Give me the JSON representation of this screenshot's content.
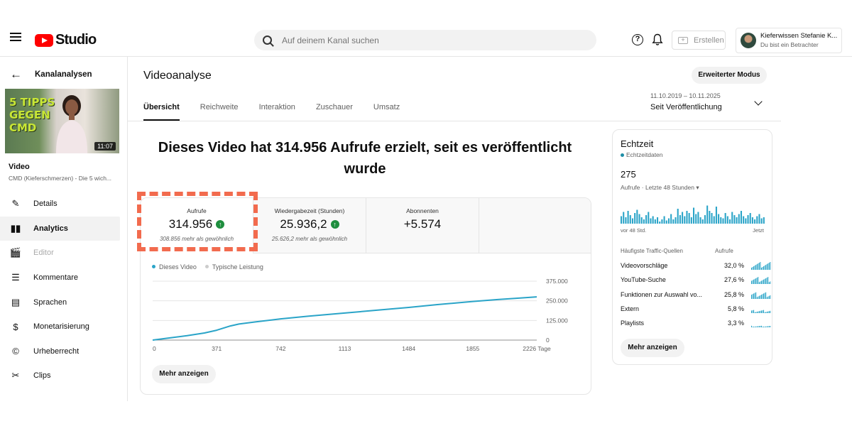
{
  "header": {
    "logo_text": "Studio",
    "search_placeholder": "Auf deinem Kanal suchen",
    "create_label": "Erstellen",
    "account_name": "Kieferwissen Stefanie K...",
    "account_role": "Du bist ein Betrachter",
    "help_glyph": "?"
  },
  "sidebar": {
    "back_label": "Kanalanalysen",
    "thumbnail_title": [
      "5 TIPPS",
      "GEGEN",
      "CMD"
    ],
    "thumbnail_duration": "11:07",
    "video_label": "Video",
    "video_subtitle": "CMD (Kieferschmerzen) - Die 5 wich...",
    "items": [
      {
        "label": "Details",
        "icon": "pencil-icon",
        "glyph": "✎",
        "state": "normal"
      },
      {
        "label": "Analytics",
        "icon": "analytics-icon",
        "glyph": "▮▮",
        "state": "active"
      },
      {
        "label": "Editor",
        "icon": "editor-icon",
        "glyph": "🎬",
        "state": "disabled"
      },
      {
        "label": "Kommentare",
        "icon": "comments-icon",
        "glyph": "☰",
        "state": "normal"
      },
      {
        "label": "Sprachen",
        "icon": "subtitles-icon",
        "glyph": "▤",
        "state": "normal"
      },
      {
        "label": "Monetarisierung",
        "icon": "dollar-icon",
        "glyph": "$",
        "state": "normal"
      },
      {
        "label": "Urheberrecht",
        "icon": "copyright-icon",
        "glyph": "©",
        "state": "normal"
      },
      {
        "label": "Clips",
        "icon": "scissors-icon",
        "glyph": "✂",
        "state": "normal"
      }
    ]
  },
  "main": {
    "title": "Videoanalyse",
    "advanced_button": "Erweiterter Modus",
    "tabs": [
      {
        "label": "Übersicht",
        "active": true
      },
      {
        "label": "Reichweite",
        "active": false
      },
      {
        "label": "Interaktion",
        "active": false
      },
      {
        "label": "Zuschauer",
        "active": false
      },
      {
        "label": "Umsatz",
        "active": false
      }
    ],
    "date_range": "11.10.2019 – 10.11.2025",
    "date_label": "Seit Veröffentlichung",
    "headline": "Dieses Video hat 314.956 Aufrufe erzielt, seit es veröffentlicht wurde",
    "metrics": [
      {
        "label": "Aufrufe",
        "value": "314.956",
        "up": true,
        "sub": "308.856 mehr als gewöhnlich"
      },
      {
        "label": "Wiedergabezeit (Stunden)",
        "value": "25.936,2",
        "up": true,
        "sub": "25.626,2 mehr als gewöhnlich"
      },
      {
        "label": "Abonnenten",
        "value": "+5.574",
        "up": false,
        "sub": ""
      }
    ],
    "up_glyph": "↑",
    "legend": [
      {
        "name": "Dieses Video",
        "color": "#2aa4c8"
      },
      {
        "name": "Typische Leistung",
        "color": "#cccccc"
      }
    ],
    "more_button": "Mehr anzeigen"
  },
  "chart_data": {
    "type": "line",
    "x_tick_labels": [
      "0",
      "371",
      "742",
      "1113",
      "1484",
      "1855",
      "2226 Tage"
    ],
    "y_tick_labels": [
      "375.000",
      "250.000",
      "125.000",
      "0"
    ],
    "xlim": [
      0,
      2226
    ],
    "ylim": [
      0,
      375000
    ],
    "y_ticks": [
      375000,
      250000,
      125000,
      0
    ],
    "x_ticks": [
      0,
      371,
      742,
      1113,
      1484,
      1855,
      2226
    ],
    "series": [
      {
        "name": "Dieses Video",
        "color": "#2aa4c8",
        "x": [
          0,
          100,
          200,
          300,
          371,
          450,
          500,
          600,
          742,
          900,
          1113,
          1300,
          1484,
          1650,
          1855,
          2000,
          2100,
          2226
        ],
        "y": [
          0,
          14000,
          28000,
          45000,
          63000,
          90000,
          102000,
          116000,
          135000,
          152000,
          172000,
          190000,
          208000,
          226000,
          246000,
          258000,
          265000,
          275000
        ]
      }
    ]
  },
  "realtime": {
    "title": "Echtzeit",
    "live_label": "Echtzeitdaten",
    "count": "275",
    "count_label": "Aufrufe · Letzte 48 Stunden",
    "bars": [
      0.35,
      0.55,
      0.3,
      0.6,
      0.4,
      0.25,
      0.5,
      0.65,
      0.45,
      0.3,
      0.2,
      0.4,
      0.55,
      0.25,
      0.35,
      0.2,
      0.3,
      0.1,
      0.2,
      0.35,
      0.15,
      0.25,
      0.45,
      0.2,
      0.3,
      0.7,
      0.4,
      0.55,
      0.35,
      0.6,
      0.5,
      0.3,
      0.75,
      0.45,
      0.55,
      0.3,
      0.2,
      0.4,
      0.85,
      0.6,
      0.5,
      0.35,
      0.8,
      0.45,
      0.3,
      0.25,
      0.5,
      0.35,
      0.2,
      0.55,
      0.4,
      0.3,
      0.45,
      0.6,
      0.35,
      0.25,
      0.4,
      0.5,
      0.3,
      0.2,
      0.35,
      0.45,
      0.25,
      0.3
    ],
    "axis_start": "vor 48 Std.",
    "axis_end": "Jetzt",
    "table_header_source": "Häufigste Traffic-Quellen",
    "table_header_views": "Aufrufe",
    "sources": [
      {
        "name": "Videovorschläge",
        "pct": "32,0 %"
      },
      {
        "name": "YouTube-Suche",
        "pct": "27,6 %"
      },
      {
        "name": "Funktionen zur Auswahl vo...",
        "pct": "25,8 %"
      },
      {
        "name": "Extern",
        "pct": "5,8 %"
      },
      {
        "name": "Playlists",
        "pct": "3,3 %"
      }
    ],
    "spark_density": [
      1.0,
      0.9,
      0.85,
      0.4,
      0.2
    ],
    "more_button": "Mehr anzeigen"
  }
}
